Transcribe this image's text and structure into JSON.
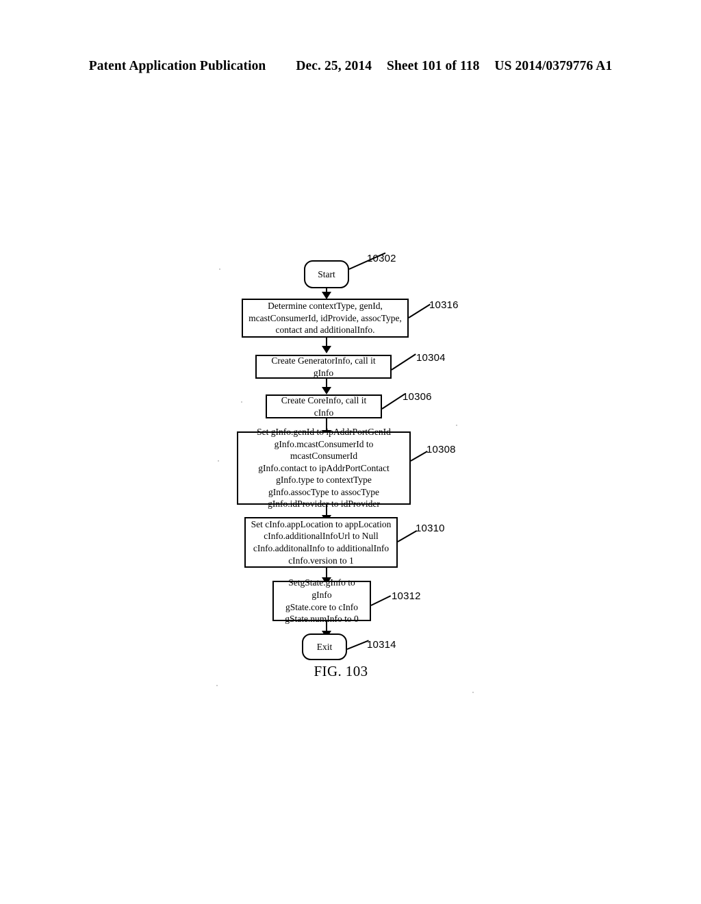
{
  "header": {
    "publication": "Patent Application Publication",
    "date": "Dec. 25, 2014",
    "sheet": "Sheet 101 of 118",
    "docnum": "US 2014/0379776 A1"
  },
  "figure": {
    "caption": "FIG. 103",
    "nodes": [
      {
        "id": "10302",
        "type": "terminal",
        "text": "Start",
        "ref": "10302"
      },
      {
        "id": "10316",
        "type": "process",
        "text": "Determine contextType, genId,\nmcastConsumerId, idProvide, assocType,\ncontact and additionalInfo.",
        "ref": "10316"
      },
      {
        "id": "10304",
        "type": "process",
        "text": "Create GeneratorInfo, call it gInfo",
        "ref": "10304"
      },
      {
        "id": "10306",
        "type": "process",
        "text": "Create CoreInfo, call it cInfo",
        "ref": "10306"
      },
      {
        "id": "10308",
        "type": "process",
        "text": "Set gInfo.genId to ipAddrPortGenId\ngInfo.mcastConsumerId to mcastConsumerId\ngInfo.contact to ipAddrPortContact\ngInfo.type to contextType\ngInfo.assocType to assocType\ngInfo.idProvider to idProvider",
        "ref": "10308"
      },
      {
        "id": "10310",
        "type": "process",
        "text": "Set cInfo.appLocation to appLocation\ncInfo.additionalInfoUrl to Null\ncInfo.additonalInfo to additionalInfo\ncInfo.version to 1",
        "ref": "10310"
      },
      {
        "id": "10312",
        "type": "process",
        "text": "SetgState.gInfo to gInfo\ngState.core to cInfo\ngState.numInfo to 0",
        "ref": "10312"
      },
      {
        "id": "10314",
        "type": "terminal",
        "text": "Exit",
        "ref": "10314"
      }
    ]
  },
  "colors": {
    "ink": "#000000",
    "paper": "#ffffff"
  }
}
